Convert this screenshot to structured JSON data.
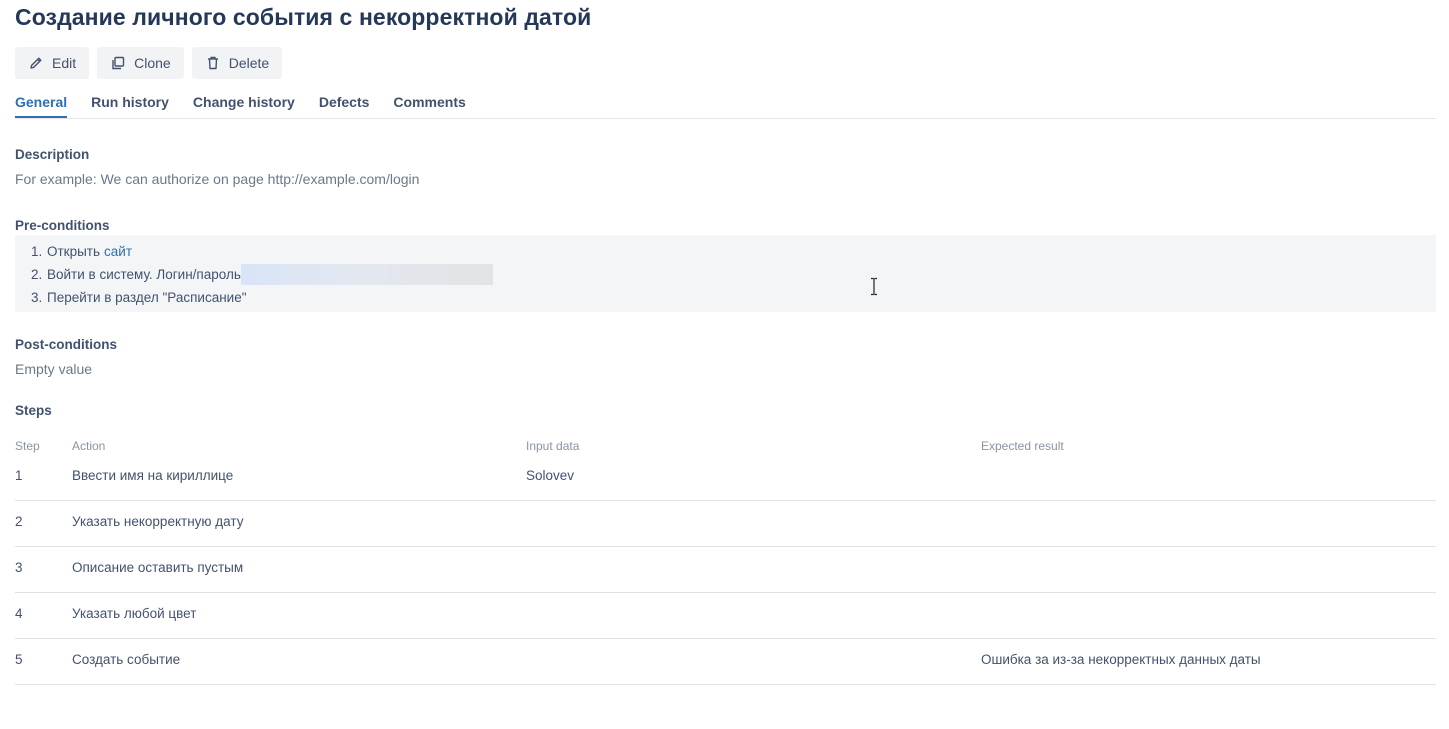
{
  "page": {
    "title": "Создание личного события с некорректной датой"
  },
  "toolbar": {
    "edit_label": "Edit",
    "clone_label": "Clone",
    "delete_label": "Delete",
    "icons": {
      "edit": "pencil-icon",
      "clone": "copy-icon",
      "delete": "trash-icon"
    }
  },
  "tabs": [
    {
      "label": "General",
      "active": true
    },
    {
      "label": "Run history",
      "active": false
    },
    {
      "label": "Change history",
      "active": false
    },
    {
      "label": "Defects",
      "active": false
    },
    {
      "label": "Comments",
      "active": false
    }
  ],
  "description": {
    "heading": "Description",
    "placeholder": "For example: We can authorize on page http://example.com/login"
  },
  "preconditions": {
    "heading": "Pre-conditions",
    "items": [
      {
        "num": "1.",
        "text": "Открыть",
        "link": "сайт"
      },
      {
        "num": "2.",
        "text": "Войти в систему. Логин/пароль"
      },
      {
        "num": "3.",
        "text": "Перейти в раздел \"Расписание\""
      }
    ]
  },
  "postconditions": {
    "heading": "Post-conditions",
    "value": "Empty value"
  },
  "steps": {
    "heading": "Steps",
    "columns": [
      "Step",
      "Action",
      "Input data",
      "Expected result"
    ],
    "rows": [
      {
        "step": "1",
        "action": "Ввести имя на кириллице",
        "input": "Solovev",
        "expected": ""
      },
      {
        "step": "2",
        "action": "Указать некорректную дату",
        "input": "",
        "expected": ""
      },
      {
        "step": "3",
        "action": "Описание оставить пустым",
        "input": "",
        "expected": ""
      },
      {
        "step": "4",
        "action": "Указать любой цвет",
        "input": "",
        "expected": ""
      },
      {
        "step": "5",
        "action": "Создать событие",
        "input": "",
        "expected": "Ошибка за из-за некорректных данных даты"
      }
    ]
  },
  "colors": {
    "accent": "#2f6fb3",
    "text": "#42526e",
    "muted": "#6b778c",
    "button_bg": "#f2f3f5",
    "precondition_bg": "#f4f5f7"
  }
}
